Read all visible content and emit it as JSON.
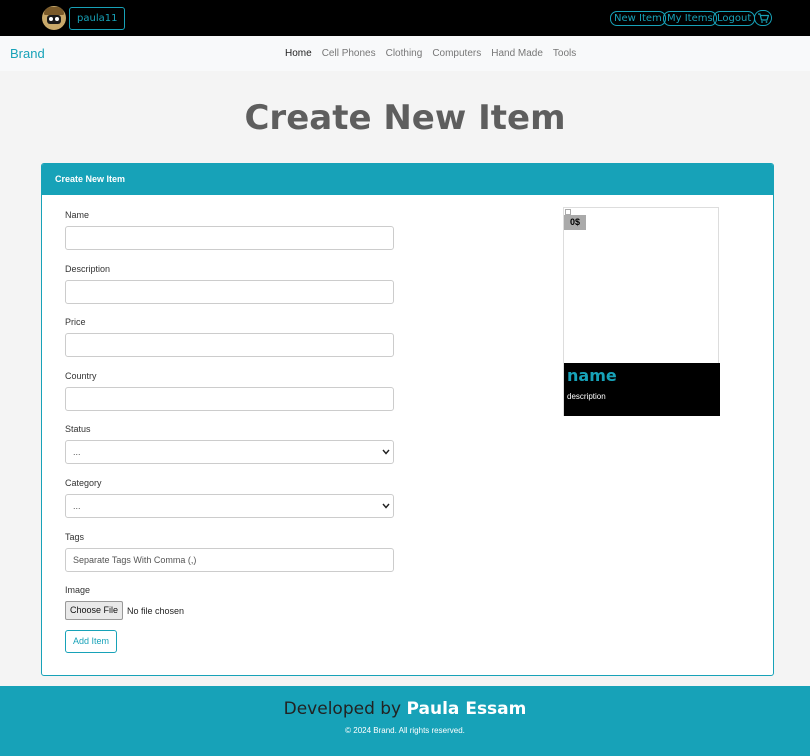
{
  "topbar": {
    "username": "paula11",
    "links": [
      "New Item",
      "My Items",
      "Logout"
    ],
    "cart_icon": "cart-icon"
  },
  "navbar": {
    "brand": "Brand",
    "links": [
      "Home",
      "Cell Phones",
      "Clothing",
      "Computers",
      "Hand Made",
      "Tools"
    ],
    "active": "Home"
  },
  "page": {
    "title": "Create New Item"
  },
  "form": {
    "header": "Create New Item",
    "name_label": "Name",
    "name_value": "",
    "description_label": "Description",
    "description_value": "",
    "price_label": "Price",
    "price_value": "",
    "country_label": "Country",
    "country_value": "",
    "status_label": "Status",
    "status_value": "...",
    "category_label": "Category",
    "category_value": "...",
    "tags_label": "Tags",
    "tags_placeholder": "Separate Tags With Comma (,)",
    "image_label": "Image",
    "choose_file": "Choose File",
    "no_file": "No file chosen",
    "submit": "Add Item"
  },
  "preview": {
    "price": "0$",
    "name": "name",
    "description": "description"
  },
  "footer": {
    "prefix": "Developed by",
    "author": "Paula Essam",
    "copyright": "© 2024 Brand. All rights reserved."
  },
  "colors": {
    "accent": "#17a2b8",
    "topbar": "#000000",
    "heading": "#5e5e5e"
  }
}
